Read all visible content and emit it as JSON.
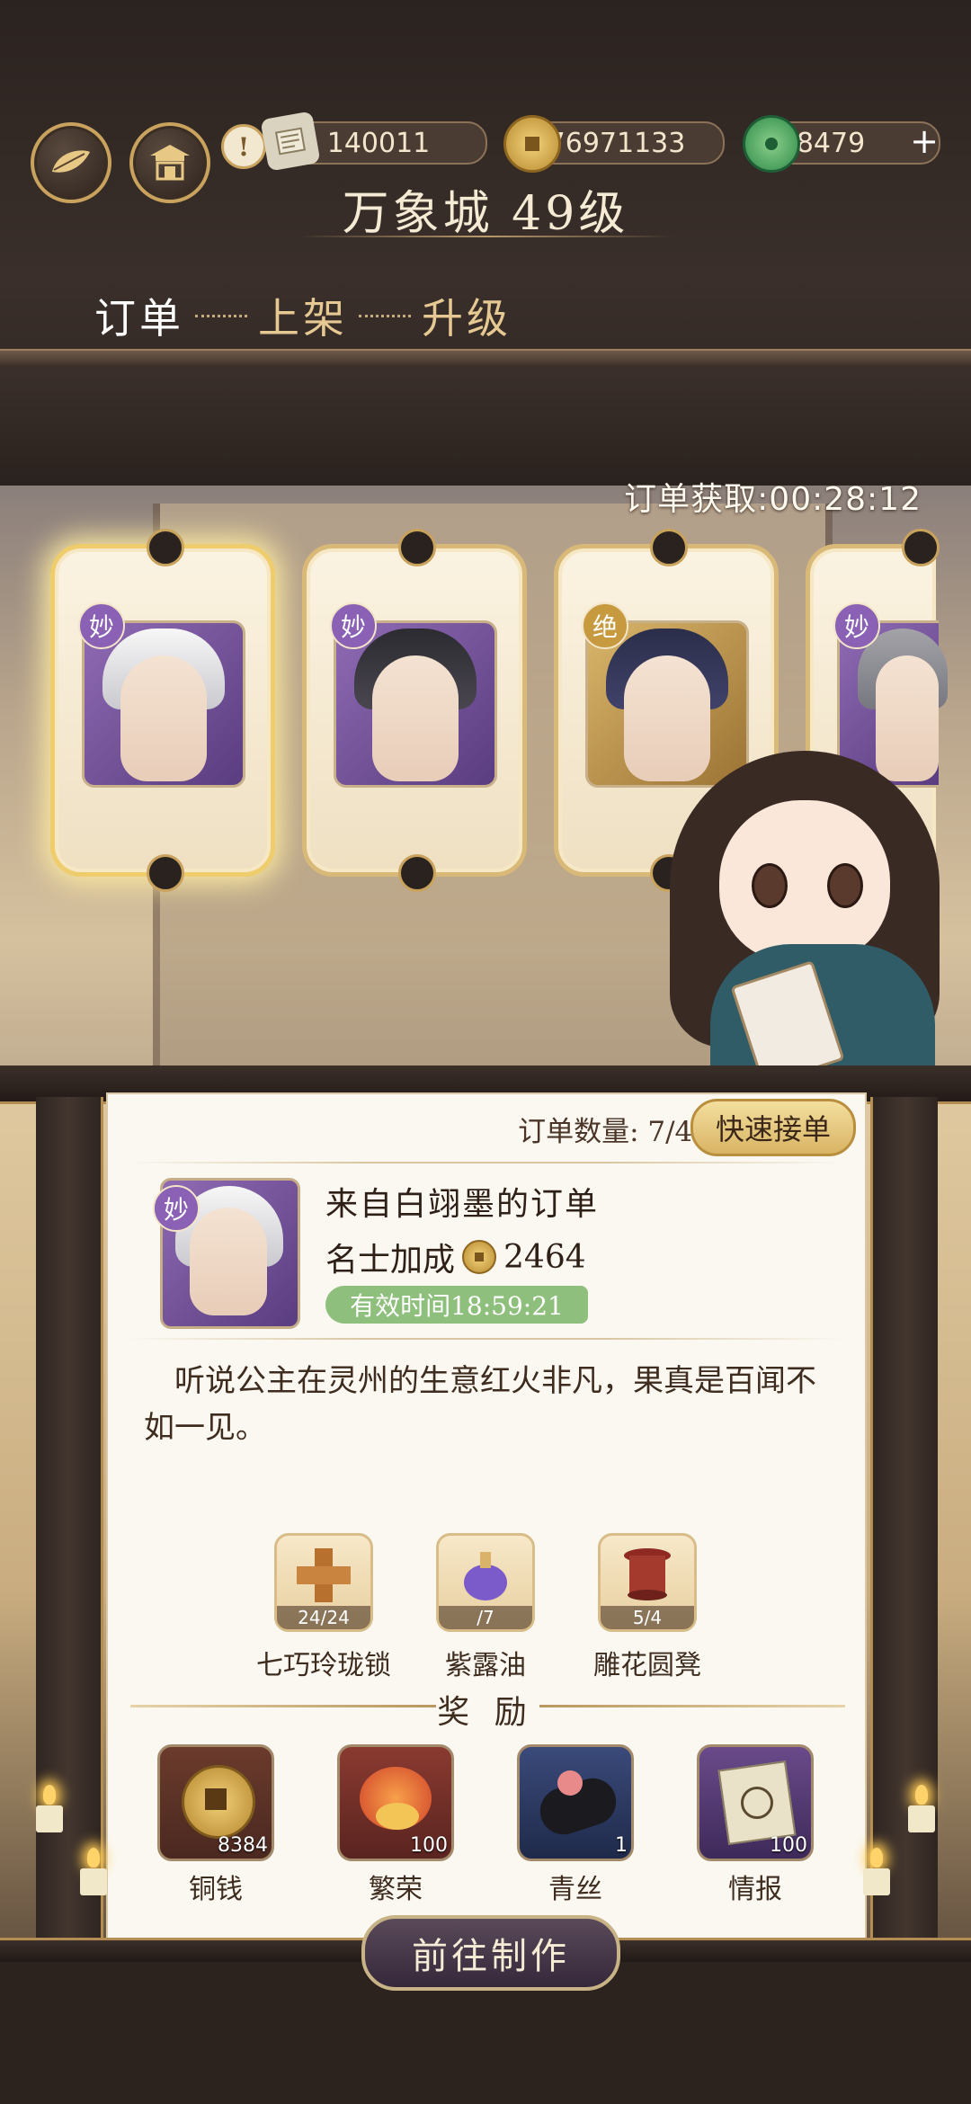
{
  "header": {
    "city_title": "万象城 49级",
    "currencies": [
      {
        "name": "ticket",
        "icon": "scroll-icon",
        "value": "140011"
      },
      {
        "name": "coin",
        "icon": "coin-icon",
        "value": "76971133"
      },
      {
        "name": "jade",
        "icon": "jade-icon",
        "value": "8479"
      }
    ],
    "add_label": "+",
    "alert_label": "!"
  },
  "tabs": [
    {
      "label": "订单",
      "active": true
    },
    {
      "label": "上架",
      "active": false
    },
    {
      "label": "升级",
      "active": false
    }
  ],
  "order_timer": "订单获取:00:28:12",
  "characters": [
    {
      "rank": "妙",
      "rank_color": "#8a61b5",
      "hair": "white"
    },
    {
      "rank": "妙",
      "rank_color": "#8a61b5",
      "hair": "dark"
    },
    {
      "rank": "绝",
      "rank_color": "#c79a40",
      "hair": "navy"
    },
    {
      "rank": "妙",
      "rank_color": "#8a61b5",
      "hair": "gray"
    }
  ],
  "order": {
    "count_label": "订单数量: 7/40",
    "quick_button": "快速接单",
    "rank": "妙",
    "from": "来自白翊墨的订单",
    "bonus_label": "名士加成",
    "bonus_value": "2464",
    "valid_time": "有效时间18:59:21",
    "description": "听说公主在灵州的生意红火非凡，果真是百闻不如一见。"
  },
  "required_items": [
    {
      "name": "七巧玲珑锁",
      "count": "24/24",
      "icon": "puzzle-lock-icon"
    },
    {
      "name": "紫露油",
      "count": "/7",
      "icon": "oil-bottle-icon"
    },
    {
      "name": "雕花圆凳",
      "count": "5/4",
      "icon": "round-stool-icon"
    }
  ],
  "rewards_title": "奖 励",
  "rewards": [
    {
      "name": "铜钱",
      "count": "8384",
      "icon": "copper-coin-icon"
    },
    {
      "name": "繁荣",
      "count": "100",
      "icon": "koi-prosperity-icon"
    },
    {
      "name": "青丝",
      "count": "1",
      "icon": "black-silk-icon"
    },
    {
      "name": "情报",
      "count": "100",
      "icon": "intel-map-icon"
    }
  ],
  "goto_button": "前往制作",
  "colors": {
    "accent_gold": "#c9a35e",
    "panel_bg": "#fbf8f2",
    "valid_green": "#8fbf7c",
    "rank_purple": "#8a61b5",
    "rank_gold": "#c79a40"
  }
}
